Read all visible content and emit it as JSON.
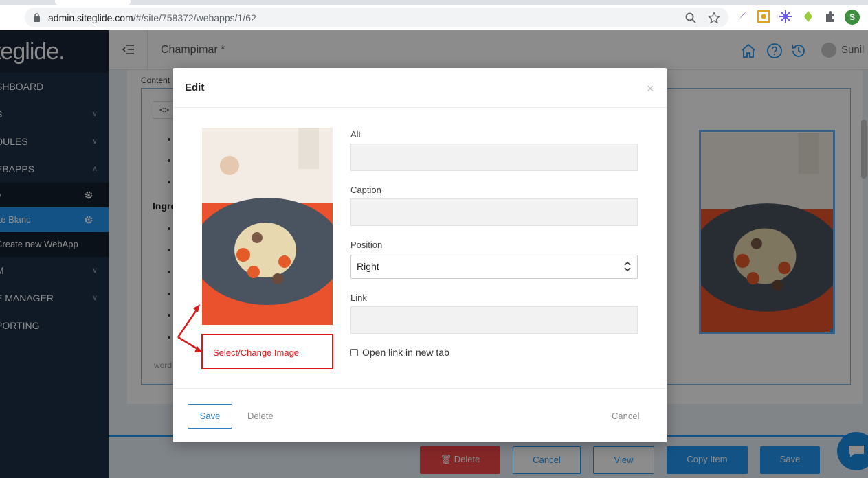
{
  "browser": {
    "url_host": "admin.siteglide.com",
    "url_path": "/#/site/758372/webapps/1/62",
    "profile_initial": "S"
  },
  "sidebar": {
    "logo": "teglide.",
    "items": [
      {
        "label": "SHBOARD"
      },
      {
        "label": "S"
      },
      {
        "label": "DULES"
      },
      {
        "label": "EBAPPS"
      }
    ],
    "sub_items": [
      {
        "label": "p"
      },
      {
        "label": "tte Blanc"
      },
      {
        "label": "Create new WebApp"
      }
    ],
    "items_after": [
      {
        "label": "M"
      },
      {
        "label": "E MANAGER"
      },
      {
        "label": "PORTING"
      }
    ]
  },
  "header": {
    "page_title": "Champimar *",
    "user_name": "Sunil"
  },
  "editor": {
    "content_label": "Content",
    "code_button": "<>",
    "ingredients_heading": "Ingre",
    "word_count_label": "word"
  },
  "action_bar": {
    "delete": "Delete",
    "cancel": "Cancel",
    "view": "View",
    "copy_item": "Copy Item",
    "save": "Save"
  },
  "modal": {
    "title": "Edit",
    "close": "×",
    "alt_label": "Alt",
    "alt_value": "",
    "caption_label": "Caption",
    "caption_value": "",
    "position_label": "Position",
    "position_value": "Right",
    "link_label": "Link",
    "link_value": "",
    "open_new_tab_label": "Open link in new tab",
    "open_new_tab_checked": false,
    "select_image_label": "Select/Change Image",
    "save": "Save",
    "delete": "Delete",
    "cancel": "Cancel"
  },
  "colors": {
    "sidebar_bg": "#1e2f45",
    "accent": "#2196f3",
    "danger": "#f44848",
    "annotation_red": "#d91a1a"
  }
}
